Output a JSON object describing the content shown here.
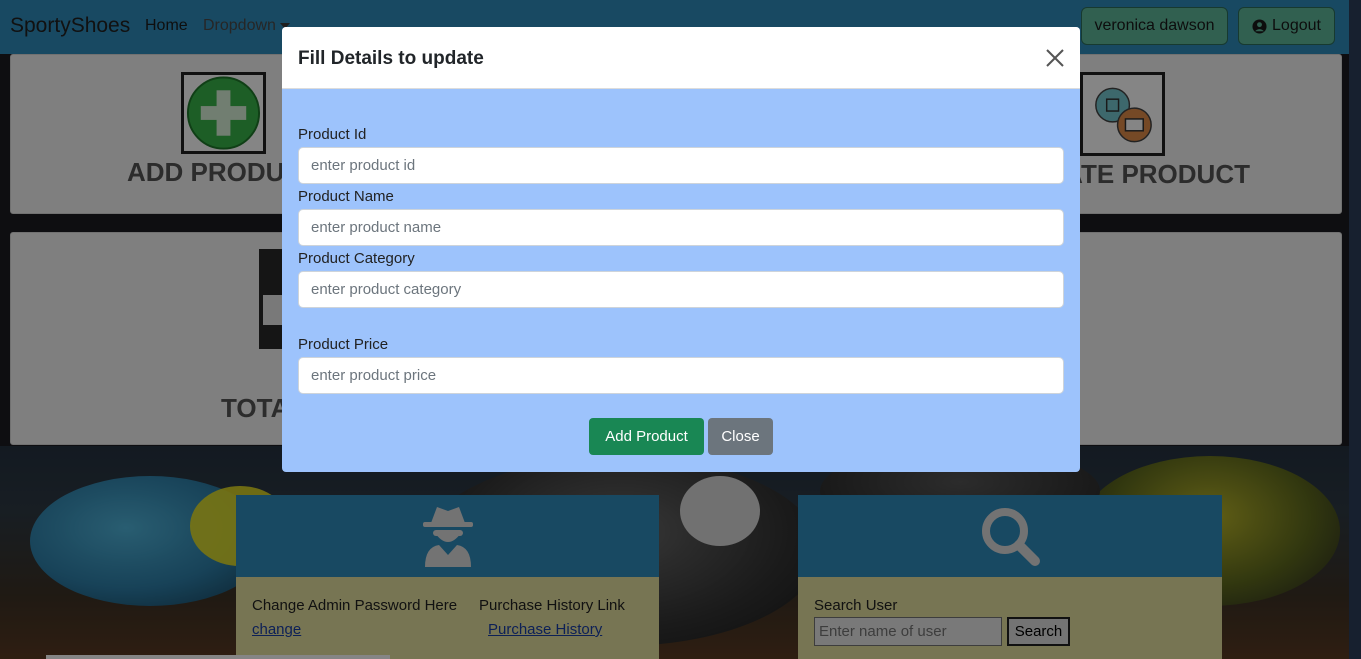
{
  "navbar": {
    "brand": "SportyShoes",
    "home": "Home",
    "dropdown": "Dropdown",
    "user": "veronica dawson",
    "logout": "Logout"
  },
  "cards": {
    "add_product": "ADD PRODUCT",
    "update_product": "UPDATE PRODUCT",
    "total": "TOTAL"
  },
  "panels": {
    "admin": {
      "change_password_label": "Change Admin Password Here",
      "change_link": "change",
      "purchase_history_label": "Purchase History Link",
      "purchase_history_link": "Purchase History"
    },
    "search": {
      "label": "Search User",
      "placeholder": "Enter name of user",
      "button": "Search"
    }
  },
  "modal": {
    "title": "Fill Details to update",
    "fields": [
      {
        "label": "Product Id",
        "placeholder": "enter product id"
      },
      {
        "label": "Product Name",
        "placeholder": "enter product name"
      },
      {
        "label": "Product Category",
        "placeholder": "enter product category"
      },
      {
        "label": "Product Price",
        "placeholder": "enter product price"
      }
    ],
    "add_button": "Add Product",
    "close_button": "Close"
  },
  "colors": {
    "navbar": "#2f8cbd",
    "modal_body": "#9dc3fc",
    "add_button": "#198754",
    "close_button": "#6c757d",
    "panel": "#e4e0a0"
  },
  "icons": [
    "chevron-down-icon",
    "user-circle-icon",
    "plus-circle-icon",
    "product-box-icon",
    "spy-icon",
    "search-icon",
    "close-icon"
  ]
}
